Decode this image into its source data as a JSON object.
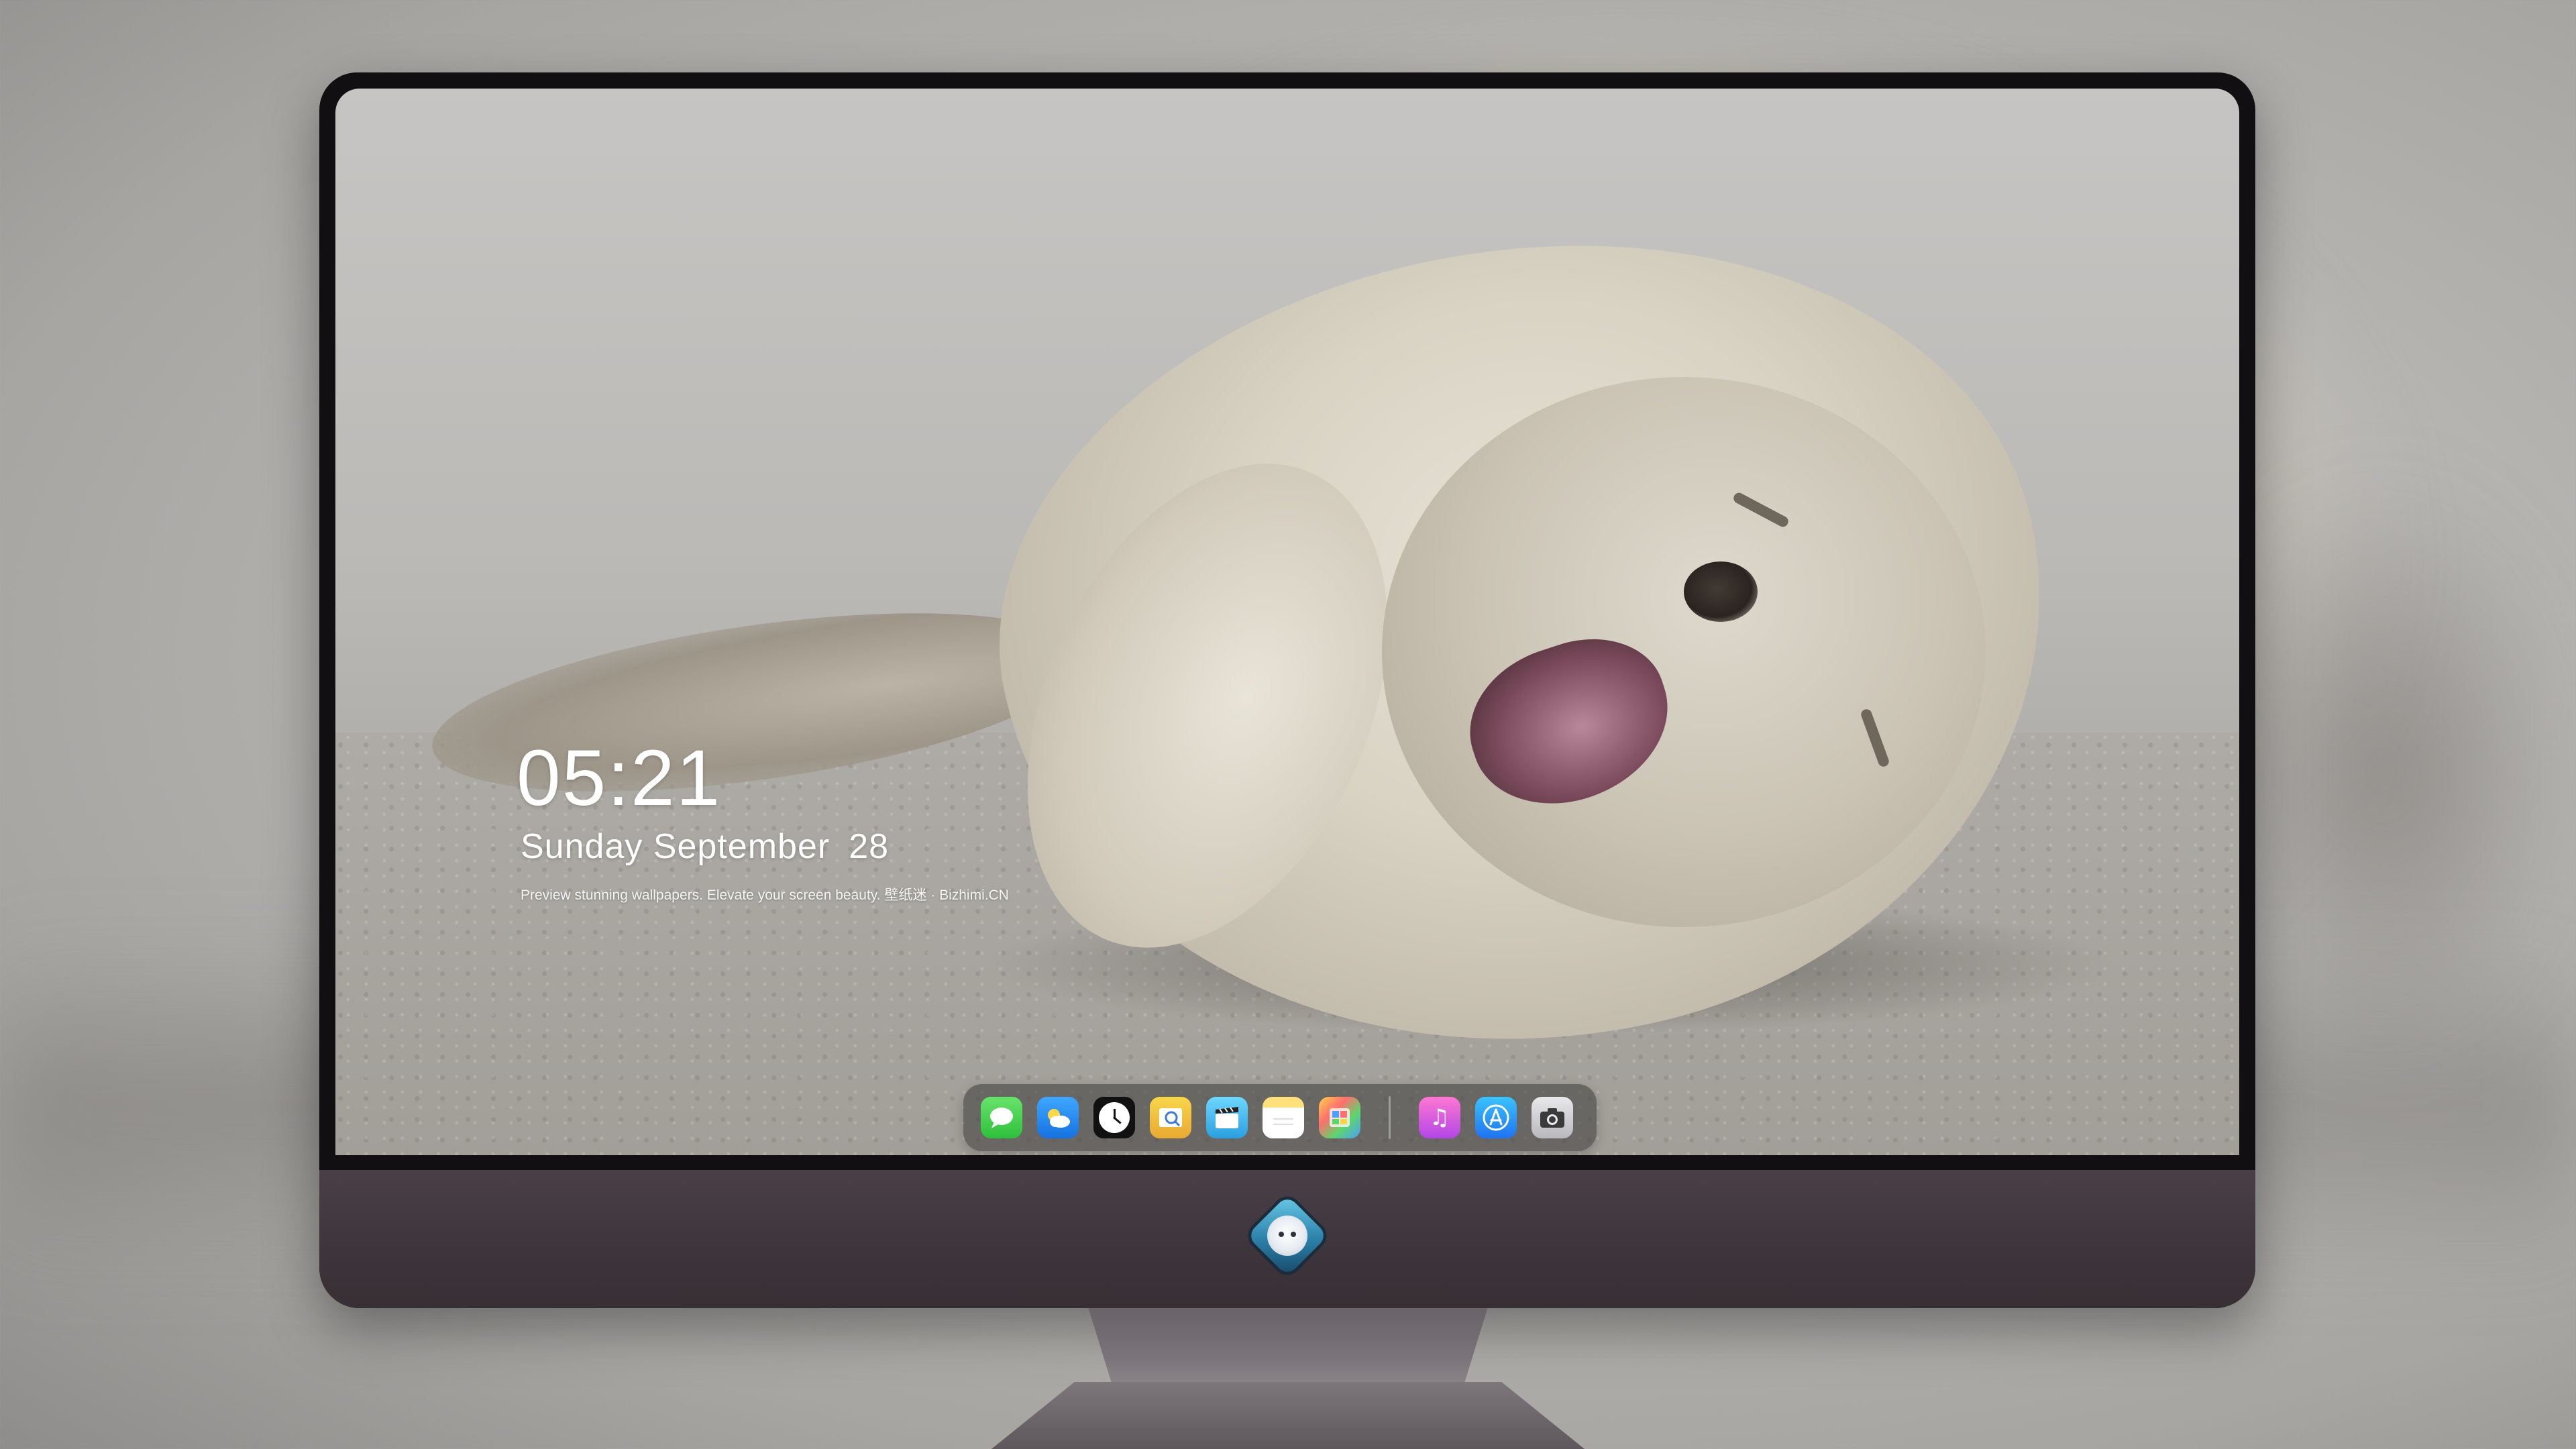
{
  "lockscreen": {
    "time": "05:21",
    "date_label": "Sunday September",
    "date_day": "28",
    "tagline": "Preview stunning wallpapers. Elevate your screen beauty. 壁纸迷 · Bizhimi.CN"
  },
  "dock": {
    "apps": [
      {
        "name": "Messages",
        "icon": "messages-icon"
      },
      {
        "name": "Weather",
        "icon": "weather-icon"
      },
      {
        "name": "Clock",
        "icon": "clock-icon"
      },
      {
        "name": "Preview",
        "icon": "preview-icon"
      },
      {
        "name": "Clips",
        "icon": "clips-icon"
      },
      {
        "name": "Notes",
        "icon": "notes-icon"
      },
      {
        "name": "Photos",
        "icon": "photos-icon"
      },
      {
        "name": "Music",
        "icon": "music-icon"
      },
      {
        "name": "App Store",
        "icon": "app-store-icon"
      },
      {
        "name": "Camera",
        "icon": "camera-icon"
      }
    ]
  },
  "colors": {
    "monitor_bezel": "#120f12",
    "monitor_chin": "#3e343b",
    "dock_bg": "rgba(70,68,66,0.62)",
    "text": "#ffffff"
  }
}
